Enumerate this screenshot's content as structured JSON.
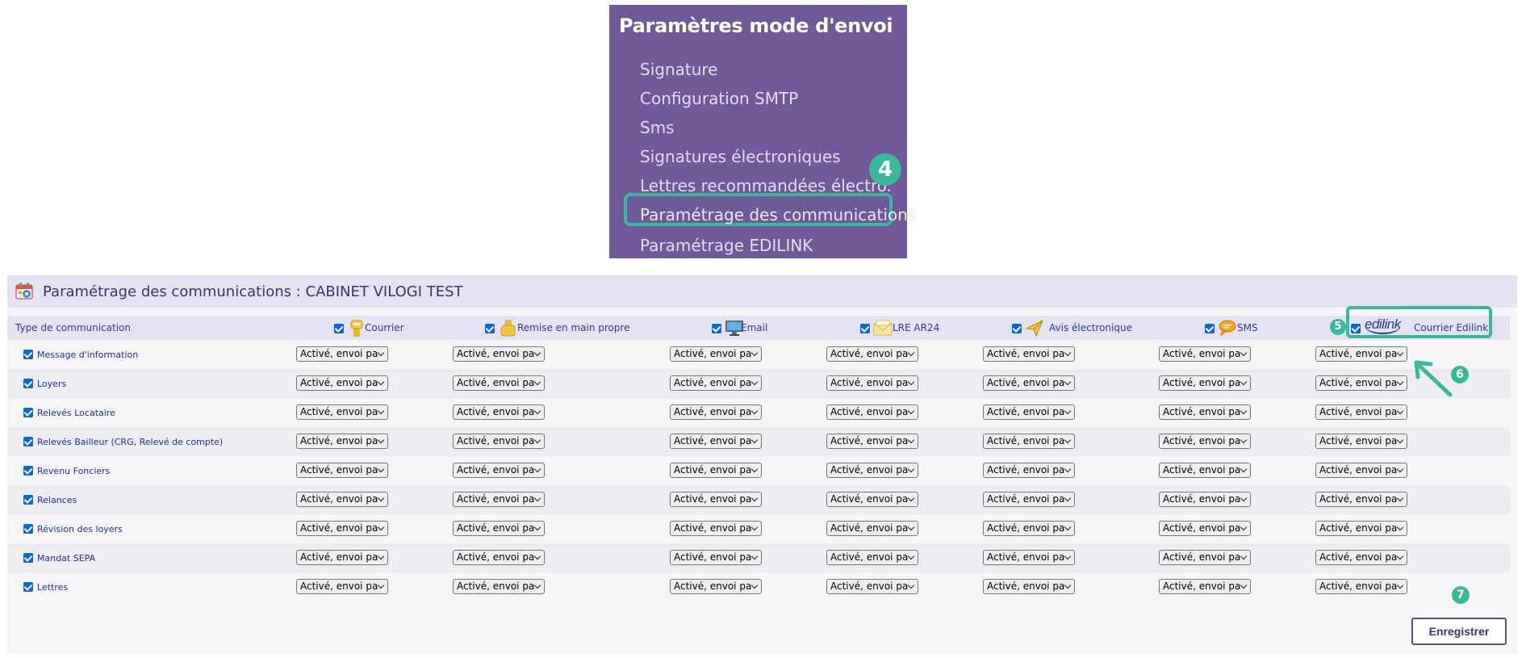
{
  "menu": {
    "title": "Paramètres mode d'envoi",
    "items": [
      {
        "label": "Signature"
      },
      {
        "label": "Configuration SMTP"
      },
      {
        "label": "Sms"
      },
      {
        "label": "Signatures électroniques"
      },
      {
        "label": "Lettres recommandées électro."
      },
      {
        "label": "Paramétrage des communications"
      },
      {
        "label": "Paramétrage EDILINK"
      }
    ],
    "step_badge": "4"
  },
  "panel": {
    "title": "Paramétrage des communications : CABINET VILOGI TEST",
    "type_header": "Type de communication",
    "columns": [
      {
        "label": "Courrier",
        "icon": "mailbox-icon",
        "checked": true
      },
      {
        "label": "Remise en main propre",
        "icon": "hand-delivery-icon",
        "checked": true
      },
      {
        "label": "Email",
        "icon": "computer-monitor-icon",
        "checked": true
      },
      {
        "label": "LRE AR24",
        "icon": "envelope-icon",
        "checked": true
      },
      {
        "label": "Avis électronique",
        "icon": "paper-plane-icon",
        "checked": true
      },
      {
        "label": "SMS",
        "icon": "speech-bubble-icon",
        "checked": true
      },
      {
        "label": "Courrier Edilink",
        "icon": "edilink-logo",
        "logo_text": "edilink",
        "checked": true
      }
    ],
    "rows": [
      {
        "label": "Message d'information"
      },
      {
        "label": "Loyers"
      },
      {
        "label": "Relevés Locataire"
      },
      {
        "label": "Relevés Bailleur (CRG, Relevé de compte)"
      },
      {
        "label": "Revenu Fonciers"
      },
      {
        "label": "Relances"
      },
      {
        "label": "Révision des loyers"
      },
      {
        "label": "Mandat SEPA"
      },
      {
        "label": "Lettres"
      }
    ],
    "select_value": "Activé, envoi par c",
    "save_label": "Enregistrer"
  },
  "badges": {
    "five": "5",
    "six": "6",
    "seven": "7"
  },
  "colors": {
    "menu_bg": "#6f5999",
    "highlight": "#3db79a",
    "header_bg": "#e5e2f3",
    "checkbox": "#0a67d4",
    "link_text": "#1e2c9a"
  }
}
